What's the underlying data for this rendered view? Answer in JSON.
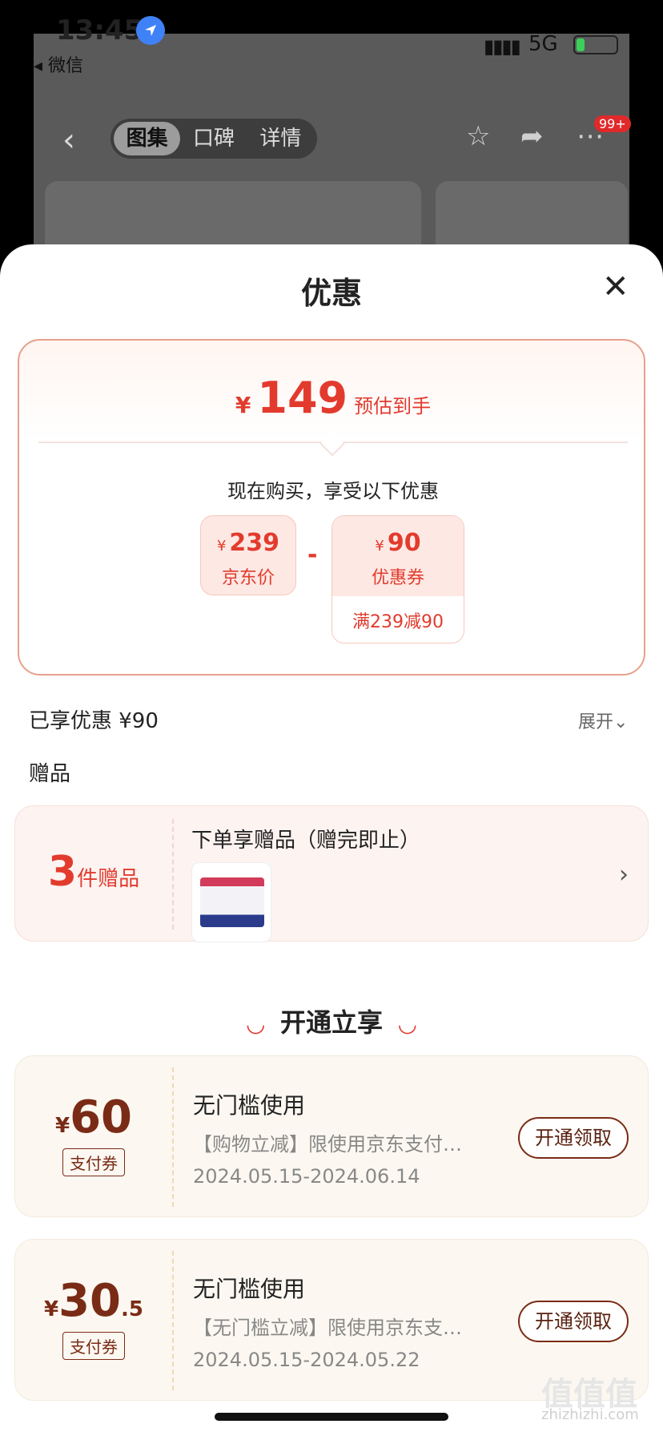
{
  "status_bar": {
    "time": "13:45",
    "back_app": "◂ 微信",
    "signal": "▮▮▮▮",
    "network": "5G"
  },
  "top_nav": {
    "tabs": [
      "图集",
      "口碑",
      "详情"
    ],
    "active_tab": 0,
    "badge": "99+"
  },
  "sheet": {
    "title": "优惠"
  },
  "price_card": {
    "currency": "¥",
    "estimated_price": "149",
    "estimated_label": "预估到手",
    "subtitle": "现在购买，享受以下优惠",
    "jd_price": {
      "currency": "¥",
      "amount": "239",
      "label": "京东价"
    },
    "operator": "-",
    "coupon": {
      "currency": "¥",
      "amount": "90",
      "label": "优惠券",
      "rule": "满239减90"
    }
  },
  "enjoyed": {
    "label": "已享优惠 ¥90",
    "expand": "展开⌄"
  },
  "gifts": {
    "title": "赠品",
    "count": "3",
    "count_unit": "件赠品",
    "headline": "下单享赠品（赠完即止）"
  },
  "vip": {
    "title": "开通立享"
  },
  "coupons": [
    {
      "yen": "¥",
      "value": "60",
      "decimal": "",
      "tag": "支付券",
      "title": "无门槛使用",
      "desc": "【购物立减】限使用京东支付…",
      "date": "2024.05.15-2024.06.14",
      "button": "开通领取"
    },
    {
      "yen": "¥",
      "value": "30",
      "decimal": ".5",
      "tag": "支付券",
      "title": "无门槛使用",
      "desc": "【无门槛立减】限使用京东支…",
      "date": "2024.05.15-2024.05.22",
      "button": "开通领取"
    }
  ],
  "watermark": {
    "main": "值值值",
    "sub": "zhizhizhi.com"
  },
  "colors": {
    "accent": "#e23b2e",
    "coupon_brown": "#7a2b16"
  }
}
